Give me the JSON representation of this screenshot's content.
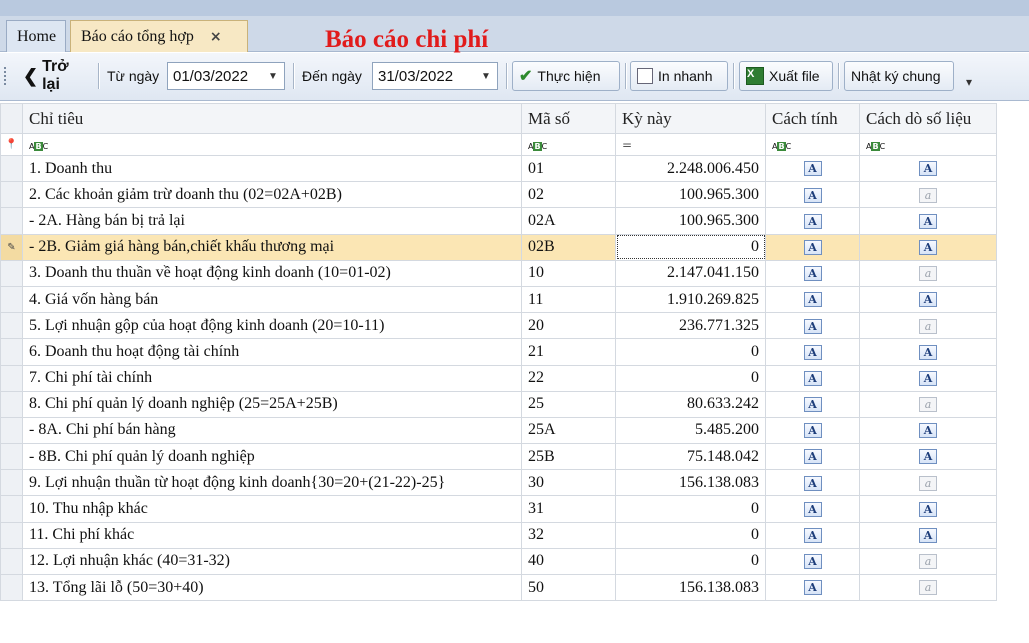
{
  "tabs": [
    {
      "label": "Home"
    },
    {
      "label": "Báo cáo tổng hợp",
      "close": "×"
    }
  ],
  "page_title": "Báo cáo chi phí",
  "toolbar": {
    "back_label": "Trở lại",
    "from_label": "Từ ngày",
    "from_value": "01/03/2022",
    "to_label": "Đến ngày",
    "to_value": "31/03/2022",
    "execute_label": "Thực hiện",
    "quick_print_label": "In nhanh",
    "export_label": "Xuất file",
    "journal_label": "Nhật ký chung"
  },
  "table": {
    "columns": [
      "Chỉ tiêu",
      "Mã số",
      "Kỳ này",
      "Cách tính",
      "Cách dò số liệu"
    ],
    "rows": [
      {
        "name": "1. Doanh thu",
        "code": "01",
        "value": "2.248.006.450",
        "calc": "A",
        "trace": "A"
      },
      {
        "name": "2. Các khoản giảm trừ doanh thu (02=02A+02B)",
        "code": "02",
        "value": "100.965.300",
        "calc": "A",
        "trace": "a"
      },
      {
        "name": " - 2A. Hàng bán bị trả lại",
        "code": "02A",
        "value": "100.965.300",
        "calc": "A",
        "trace": "A"
      },
      {
        "name": " - 2B. Giảm giá hàng bán,chiết khấu thương mại",
        "code": "02B",
        "value": "0",
        "calc": "A",
        "trace": "A"
      },
      {
        "name": "3. Doanh thu thuần về hoạt động kinh doanh (10=01-02)",
        "code": "10",
        "value": "2.147.041.150",
        "calc": "A",
        "trace": "a"
      },
      {
        "name": "4. Giá vốn hàng bán",
        "code": "11",
        "value": "1.910.269.825",
        "calc": "A",
        "trace": "A"
      },
      {
        "name": "5. Lợi nhuận gộp của hoạt động kinh doanh (20=10-11)",
        "code": "20",
        "value": "236.771.325",
        "calc": "A",
        "trace": "a"
      },
      {
        "name": "6. Doanh thu hoạt động tài chính",
        "code": "21",
        "value": "0",
        "calc": "A",
        "trace": "A"
      },
      {
        "name": "7. Chi phí tài chính",
        "code": "22",
        "value": "0",
        "calc": "A",
        "trace": "A"
      },
      {
        "name": "8. Chi phí quản lý doanh nghiệp (25=25A+25B)",
        "code": "25",
        "value": "80.633.242",
        "calc": "A",
        "trace": "a"
      },
      {
        "name": " - 8A. Chi phí bán hàng",
        "code": "25A",
        "value": "5.485.200",
        "calc": "A",
        "trace": "A"
      },
      {
        "name": " - 8B. Chi phí quản lý doanh nghiệp",
        "code": "25B",
        "value": "75.148.042",
        "calc": "A",
        "trace": "A"
      },
      {
        "name": "9. Lợi nhuận thuần từ hoạt động kinh doanh{30=20+(21-22)-25}",
        "code": "30",
        "value": "156.138.083",
        "calc": "A",
        "trace": "a"
      },
      {
        "name": "10. Thu nhập khác",
        "code": "31",
        "value": "0",
        "calc": "A",
        "trace": "A"
      },
      {
        "name": "11. Chi phí khác",
        "code": "32",
        "value": "0",
        "calc": "A",
        "trace": "A"
      },
      {
        "name": "12. Lợi nhuận khác (40=31-32)",
        "code": "40",
        "value": "0",
        "calc": "A",
        "trace": "a"
      },
      {
        "name": "13. Tổng lãi lỗ (50=30+40)",
        "code": "50",
        "value": "156.138.083",
        "calc": "A",
        "trace": "a"
      }
    ],
    "selected_row": 3
  }
}
